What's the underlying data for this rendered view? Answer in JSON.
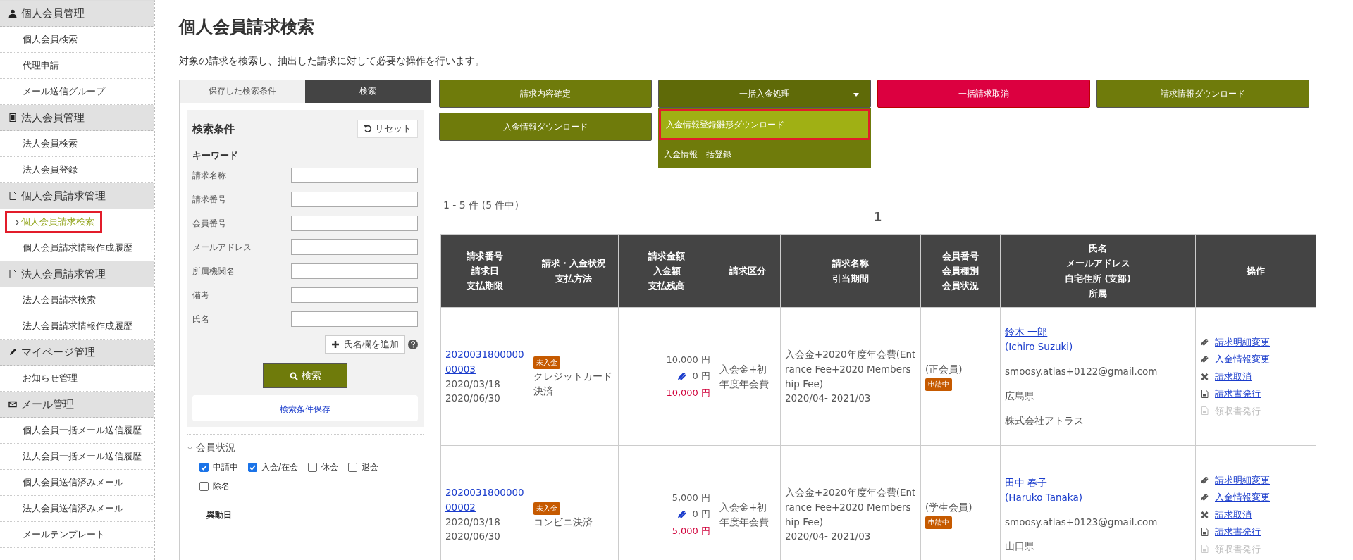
{
  "sidebar": [
    {
      "header": "個人会員管理",
      "kind": "person",
      "items": [
        {
          "label": "個人会員検索",
          "selected": false
        },
        {
          "label": "代理申請",
          "selected": false
        },
        {
          "label": "メール送信グループ",
          "selected": false
        }
      ]
    },
    {
      "header": "法人会員管理",
      "kind": "building",
      "items": [
        {
          "label": "法人会員検索",
          "selected": false
        },
        {
          "label": "法人会員登録",
          "selected": false
        }
      ]
    },
    {
      "header": "個人会員請求管理",
      "kind": "doc",
      "items": [
        {
          "label": "個人会員請求検索",
          "selected": true,
          "highlighted": true
        },
        {
          "label": "個人会員請求情報作成履歴",
          "selected": false
        }
      ]
    },
    {
      "header": "法人会員請求管理",
      "kind": "doc",
      "items": [
        {
          "label": "法人会員請求検索",
          "selected": false
        },
        {
          "label": "法人会員請求情報作成履歴",
          "selected": false
        }
      ]
    },
    {
      "header": "マイページ管理",
      "kind": "pen",
      "items": [
        {
          "label": "お知らせ管理",
          "selected": false
        }
      ]
    },
    {
      "header": "メール管理",
      "kind": "mail",
      "items": [
        {
          "label": "個人会員一括メール送信履歴",
          "selected": false
        },
        {
          "label": "法人会員一括メール送信履歴",
          "selected": false
        },
        {
          "label": "個人会員送信済みメール",
          "selected": false
        },
        {
          "label": "法人会員送信済みメール",
          "selected": false
        },
        {
          "label": "メールテンプレート",
          "selected": false
        }
      ]
    }
  ],
  "page_title": "個人会員請求検索",
  "description": "対象の請求を検索し、抽出した請求に対して必要な操作を行います。",
  "search_panel": {
    "tabs": [
      {
        "label": "保存した検索条件",
        "selected": false
      },
      {
        "label": "検索",
        "selected": true
      }
    ],
    "heading": "検索条件",
    "reset_button": "リセット",
    "keyword_label": "キーワード",
    "fields": [
      "請求名称",
      "請求番号",
      "会員番号",
      "メールアドレス",
      "所属機関名",
      "備考",
      "氏名"
    ],
    "add_name_button": "氏名欄を追加",
    "search_button": "検索",
    "save_link": "検索条件保存",
    "member_status": {
      "label": "会員状況",
      "expanded": true,
      "options": [
        {
          "label": "申請中",
          "checked": true
        },
        {
          "label": "入会/在会",
          "checked": true
        },
        {
          "label": "休会",
          "checked": false
        },
        {
          "label": "退会",
          "checked": false
        },
        {
          "label": "除名",
          "checked": false
        }
      ]
    },
    "date_label": "異動日"
  },
  "actions": [
    {
      "label": "請求内容確定",
      "kind": "primary"
    },
    {
      "label": "一括入金処理",
      "kind": "dropdown",
      "expanded": true,
      "menu": [
        {
          "label": "入金情報登録雛形ダウンロード",
          "highlighted": true
        },
        {
          "label": "入金情報一括登録",
          "highlighted": false
        }
      ]
    },
    {
      "label": "一括請求取消",
      "kind": "danger"
    },
    {
      "label": "請求情報ダウンロード",
      "kind": "primary"
    },
    {
      "label": "入金情報ダウンロード",
      "kind": "primary"
    }
  ],
  "result_count": "1 - 5 件 (5 件中)",
  "pagination": [
    "1"
  ],
  "table": {
    "columns": [
      [
        "請求番号",
        "請求日",
        "支払期限"
      ],
      [
        "請求・入金状況",
        "支払方法"
      ],
      [
        "請求金額",
        "入金額",
        "支払残高"
      ],
      [
        "請求区分"
      ],
      [
        "請求名称",
        "引当期間"
      ],
      [
        "会員番号",
        "会員種別",
        "会員状況"
      ],
      [
        "氏名",
        "メールアドレス",
        "自宅住所 (支部)",
        "所属"
      ],
      [
        "操作"
      ]
    ],
    "rows": [
      {
        "invoice_no": "202003180000000003",
        "invoice_date": "2020/03/18",
        "due_date": "2020/06/30",
        "status_badge": "未入金",
        "payment_method": "クレジットカード決済",
        "amount": "10,000 円",
        "paid": "0 円",
        "balance": "10,000 円",
        "category": "入会金+初年度年会費",
        "name": "入会金+2020年度年会費(Entrance Fee+2020 Membership Fee)",
        "period": "2020/04- 2021/03",
        "member_type": "(正会員)",
        "member_status": "申請中",
        "person_name": "鈴木 一郎",
        "person_name_en": "(Ichiro Suzuki)",
        "email": "smoosy.atlas+0122@gmail.com",
        "address": "広島県",
        "affiliation": "株式会社アトラス",
        "operations": [
          {
            "label": "請求明細変更",
            "kind": "pen",
            "disabled": false
          },
          {
            "label": "入金情報変更",
            "kind": "pen",
            "disabled": false
          },
          {
            "label": "請求取消",
            "kind": "cross",
            "disabled": false
          },
          {
            "label": "請求書発行",
            "kind": "doc",
            "disabled": false
          },
          {
            "label": "領収書発行",
            "kind": "doc",
            "disabled": true
          }
        ]
      },
      {
        "invoice_no": "202003180000000002",
        "invoice_date": "2020/03/18",
        "due_date": "2020/06/30",
        "status_badge": "未入金",
        "payment_method": "コンビニ決済",
        "amount": "5,000 円",
        "paid": "0 円",
        "balance": "5,000 円",
        "category": "入会金+初年度年会費",
        "name": "入会金+2020年度年会費(Entrance Fee+2020 Membership Fee)",
        "period": "2020/04- 2021/03",
        "member_type": "(学生会員)",
        "member_status": "申請中",
        "person_name": "田中 春子",
        "person_name_en": "(Haruko Tanaka)",
        "email": "smoosy.atlas+0123@gmail.com",
        "address": "山口県",
        "operations": [
          {
            "label": "請求明細変更",
            "kind": "pen",
            "disabled": false
          },
          {
            "label": "入金情報変更",
            "kind": "pen",
            "disabled": false
          },
          {
            "label": "請求取消",
            "kind": "cross",
            "disabled": false
          },
          {
            "label": "請求書発行",
            "kind": "doc",
            "disabled": false
          },
          {
            "label": "領収書発行",
            "kind": "doc",
            "disabled": true
          }
        ]
      }
    ]
  }
}
